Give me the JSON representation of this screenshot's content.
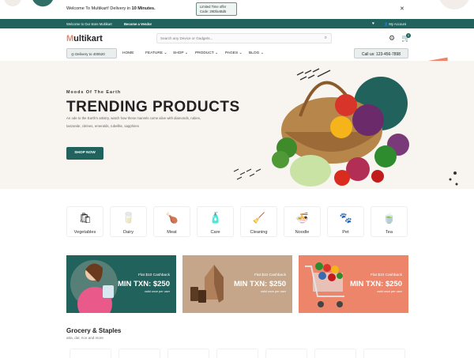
{
  "promo": {
    "prefix": "Welcome To Multikart! Delivery in ",
    "highlight": "10 Minutes.",
    "offer_line1": "Limited Time offer",
    "offer_line2": "Code: 29Dfa4Bd5",
    "close": "✕"
  },
  "topbar": {
    "welcome": "Welcome to Our store Multikart",
    "vendor": "Become a Vendor",
    "account": "My Account",
    "heart_icon": "heart-icon",
    "account_icon": "user-icon"
  },
  "header": {
    "logo_m": "M",
    "logo_rest": "ultikart",
    "search_placeholder": "Search any Device or Gadgets...",
    "cart_count": "0"
  },
  "nav": {
    "delivery": "Delivery to 400520",
    "items": [
      "HOME",
      "FEATURE",
      "SHOP",
      "PRODUCT",
      "PAGES",
      "BLOG"
    ],
    "call": "Call us: 123-456-7898"
  },
  "hero": {
    "kicker": "Moods Of The Earth",
    "title": "TRENDING PRODUCTS",
    "desc": "An ode to the Earth's artistry, watch how these marvels come alive with diamonds, rubies, tanzanite, citrines, emeralds, rubellite, sapphires",
    "button": "SHOP NOW"
  },
  "categories": [
    {
      "label": "Vegetables",
      "icon": "🛍"
    },
    {
      "label": "Dairy",
      "icon": "🥛"
    },
    {
      "label": "Meat",
      "icon": "🍗"
    },
    {
      "label": "Care",
      "icon": "🧴"
    },
    {
      "label": "Cleaning",
      "icon": "🧹"
    },
    {
      "label": "Noodle",
      "icon": "🍜"
    },
    {
      "label": "Pet",
      "icon": "🐾"
    },
    {
      "label": "Tea",
      "icon": "🍵"
    }
  ],
  "banners": [
    {
      "flat": "Flat $10 Cashback",
      "min": "MIN TXN: $250",
      "valid": "valid once per user",
      "color": "#22625c"
    },
    {
      "flat": "Flat $10 Cashback",
      "min": "MIN TXN: $250",
      "valid": "valid once per user",
      "color": "#c5a68a"
    },
    {
      "flat": "Flat $10 Cashback",
      "min": "MIN TXN: $250",
      "valid": "valid once per user",
      "color": "#ec8569"
    }
  ],
  "section": {
    "title": "Grocery & Staples",
    "subtitle": "atta, dal, rice and more"
  },
  "colors": {
    "primary": "#22625c",
    "accent": "#ec8569"
  }
}
